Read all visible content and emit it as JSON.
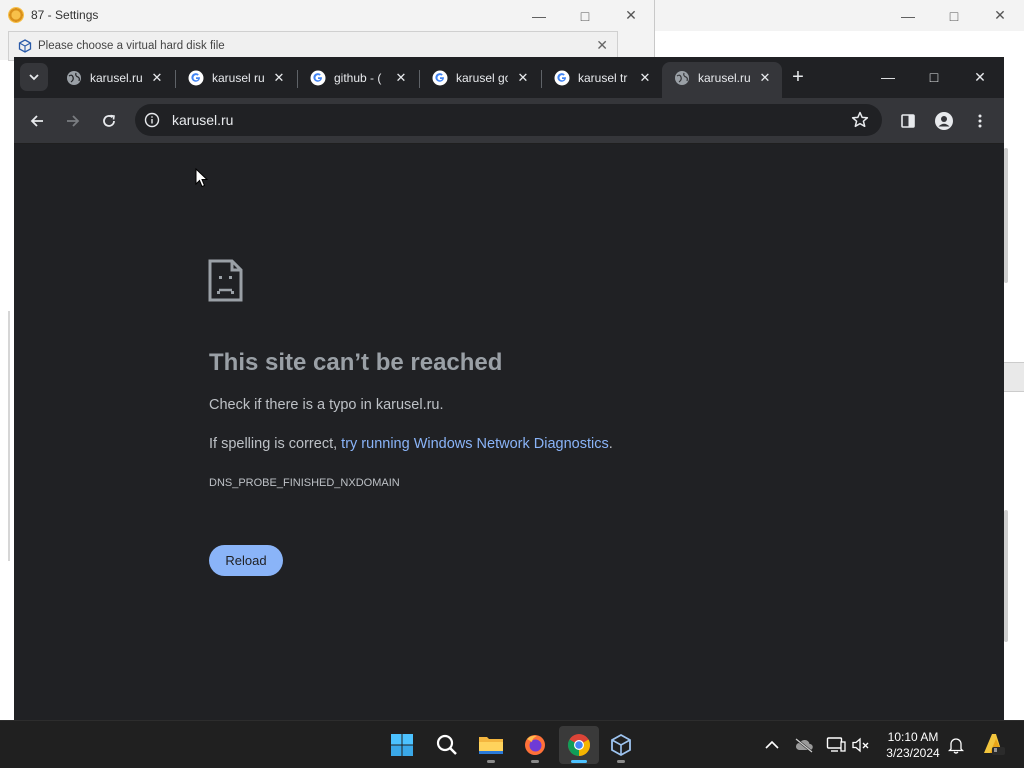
{
  "settings_window": {
    "title": "87 - Settings"
  },
  "vbox_dialog": {
    "title": "Please choose a virtual hard disk file"
  },
  "browser": {
    "tabs": [
      {
        "label": "karusel.ru",
        "favicon": "globe-icon",
        "active": false
      },
      {
        "label": "karusel ru",
        "favicon": "google-icon",
        "active": false
      },
      {
        "label": "github - (",
        "favicon": "google-icon",
        "active": false
      },
      {
        "label": "karusel go",
        "favicon": "google-icon",
        "active": false
      },
      {
        "label": "karusel tr",
        "favicon": "google-icon",
        "active": false
      },
      {
        "label": "karusel.ru",
        "favicon": "globe-icon",
        "active": true
      }
    ],
    "address": "karusel.ru"
  },
  "error_page": {
    "title": "This site can’t be reached",
    "line1": "Check if there is a typo in karusel.ru.",
    "line2_prefix": "If spelling is correct, ",
    "line2_link": "try running Windows Network Diagnostics",
    "line2_suffix": ".",
    "error_code": "DNS_PROBE_FINISHED_NXDOMAIN",
    "reload_label": "Reload"
  },
  "taskbar": {
    "apps": [
      "start-icon",
      "search-icon",
      "file-explorer-icon",
      "firefox-icon",
      "chrome-icon",
      "virtualbox-icon"
    ],
    "active_app": "chrome-icon",
    "time": "10:10 AM",
    "date": "3/23/2024"
  },
  "colors": {
    "chrome_frame": "#202124",
    "chrome_toolbar": "#35363a",
    "link": "#8ab4f8",
    "button": "#8ab4f8",
    "taskbar": "#202020",
    "accent": "#4cc2ff"
  }
}
